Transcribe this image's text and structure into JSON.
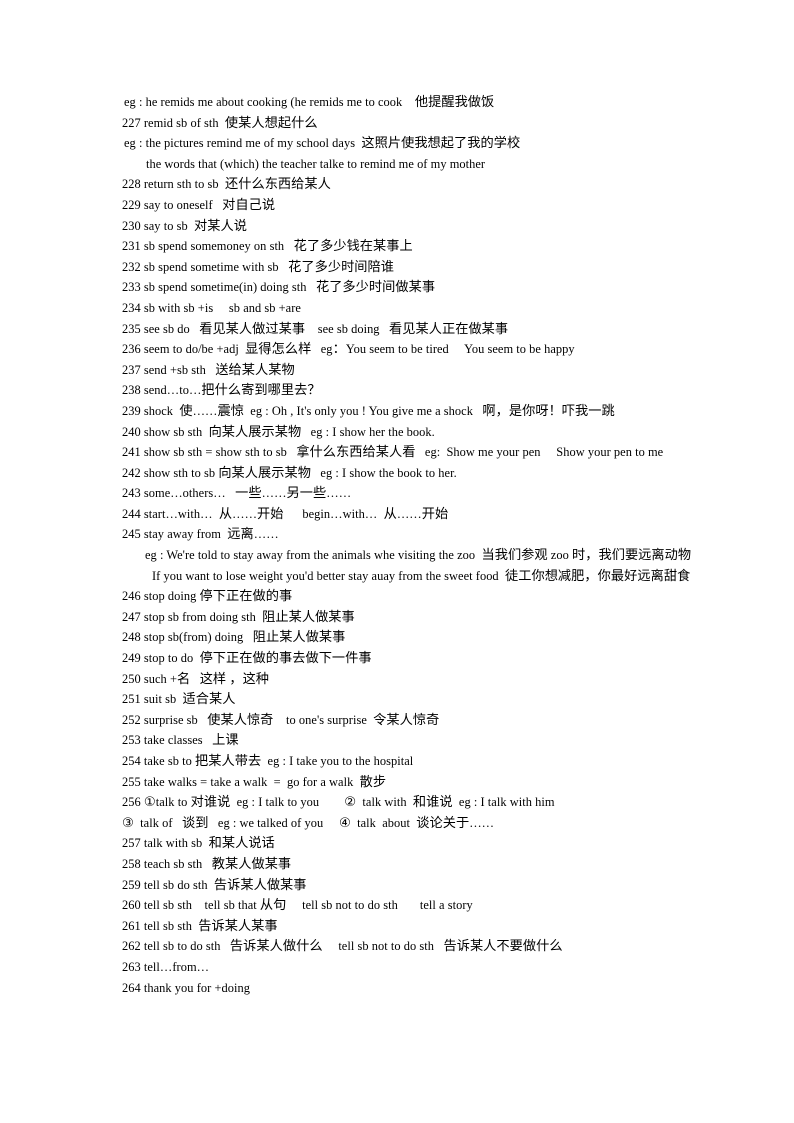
{
  "document": {
    "type": "study-notes",
    "language": "en-zh",
    "page_background": "#ffffff",
    "text_color": "#000000",
    "topic": "English phrase list with Chinese translations (items 227-264)",
    "lines": [
      {
        "id": "l1",
        "indent": "eg",
        "text": "eg : he remids me about cooking (he remids me to cook    他提醒我做饭"
      },
      {
        "id": "l2",
        "indent": "none",
        "text": "227 remid sb of sth  使某人想起什么"
      },
      {
        "id": "l3",
        "indent": "eg",
        "text": "eg : the pictures remind me of my school days  这照片使我想起了我的学校"
      },
      {
        "id": "l4",
        "indent": "deep",
        "text": "the words that (which) the teacher talke to remind me of my mother"
      },
      {
        "id": "l5",
        "indent": "none",
        "text": "228 return sth to sb  还什么东西给某人"
      },
      {
        "id": "l6",
        "indent": "none",
        "text": "229 say to oneself   对自己说"
      },
      {
        "id": "l7",
        "indent": "none",
        "text": "230 say to sb  对某人说"
      },
      {
        "id": "l8",
        "indent": "none",
        "text": "231 sb spend somemoney on sth   花了多少钱在某事上"
      },
      {
        "id": "l9",
        "indent": "none",
        "text": "232 sb spend sometime with sb   花了多少时间陪谁"
      },
      {
        "id": "l10",
        "indent": "none",
        "text": "233 sb spend sometime(in) doing sth   花了多少时间做某事"
      },
      {
        "id": "l11",
        "indent": "none",
        "text": "234 sb with sb +is     sb and sb +are"
      },
      {
        "id": "l12",
        "indent": "none",
        "text": "235 see sb do   看见某人做过某事    see sb doing   看见某人正在做某事"
      },
      {
        "id": "l13",
        "indent": "none",
        "text": "236 seem to do/be +adj  显得怎么样   eg：You seem to be tired     You seem to be happy"
      },
      {
        "id": "l14",
        "indent": "none",
        "text": "237 send +sb sth   送给某人某物"
      },
      {
        "id": "l15",
        "indent": "none",
        "text": "238 send…to…把什么寄到哪里去？"
      },
      {
        "id": "l16",
        "indent": "none",
        "text": "239 shock  使……震惊  eg : Oh , It's only you ! You give me a shock   啊，是你呀！吓我一跳"
      },
      {
        "id": "l17",
        "indent": "none",
        "text": "240 show sb sth  向某人展示某物   eg : I show her the book."
      },
      {
        "id": "l18",
        "indent": "none",
        "text": "241 show sb sth = show sth to sb   拿什么东西给某人看   eg:  Show me your pen     Show your pen to me"
      },
      {
        "id": "l19",
        "indent": "none",
        "text": "242 show sth to sb 向某人展示某物   eg : I show the book to her."
      },
      {
        "id": "l20",
        "indent": "none",
        "text": "243 some…others…   一些……另一些……"
      },
      {
        "id": "l21",
        "indent": "none",
        "text": "244 start…with…  从……开始      begin…with…  从……开始"
      },
      {
        "id": "l22",
        "indent": "none",
        "text": "245 stay away from  远离……"
      },
      {
        "id": "l23",
        "indent": "eg2",
        "text": "eg : We're told to stay away from the animals whe visiting the zoo  当我们参观 zoo 时，我们要远离动物"
      },
      {
        "id": "l24",
        "indent": "deep2",
        "text": "If you want to lose weight you'd better stay auay from the sweet food  徒工你想减肥，你最好远离甜食"
      },
      {
        "id": "l25",
        "indent": "none",
        "text": "246 stop doing 停下正在做的事"
      },
      {
        "id": "l26",
        "indent": "none",
        "text": "247 stop sb from doing sth  阻止某人做某事"
      },
      {
        "id": "l27",
        "indent": "none",
        "text": "248 stop sb(from) doing   阻止某人做某事"
      },
      {
        "id": "l28",
        "indent": "none",
        "text": "249 stop to do  停下正在做的事去做下一件事"
      },
      {
        "id": "l29",
        "indent": "none",
        "text": "250 such +名   这样 ，这种"
      },
      {
        "id": "l30",
        "indent": "none",
        "text": "251 suit sb  适合某人"
      },
      {
        "id": "l31",
        "indent": "none",
        "text": "252 surprise sb   使某人惊奇    to one's surprise  令某人惊奇"
      },
      {
        "id": "l32",
        "indent": "none",
        "text": "253 take classes   上课"
      },
      {
        "id": "l33",
        "indent": "none",
        "text": "254 take sb to 把某人带去  eg : I take you to the hospital"
      },
      {
        "id": "l34",
        "indent": "none",
        "text": "255 take walks = take a walk  =  go for a walk  散步"
      },
      {
        "id": "l35",
        "indent": "none",
        "text": "256 ①talk to 对谁说  eg : I talk to you        ②  talk with  和谁说  eg : I talk with him"
      },
      {
        "id": "l36",
        "indent": "none",
        "text": "③  talk of   谈到   eg : we talked of you     ④  talk  about  谈论关于……"
      },
      {
        "id": "l37",
        "indent": "none",
        "text": "257 talk with sb  和某人说话"
      },
      {
        "id": "l38",
        "indent": "none",
        "text": "258 teach sb sth   教某人做某事"
      },
      {
        "id": "l39",
        "indent": "none",
        "text": "259 tell sb do sth  告诉某人做某事"
      },
      {
        "id": "l40",
        "indent": "none",
        "text": "260 tell sb sth    tell sb that 从句     tell sb not to do sth       tell a story"
      },
      {
        "id": "l41",
        "indent": "none",
        "text": "261 tell sb sth  告诉某人某事"
      },
      {
        "id": "l42",
        "indent": "none",
        "text": "262 tell sb to do sth   告诉某人做什么     tell sb not to do sth   告诉某人不要做什么"
      },
      {
        "id": "l43",
        "indent": "none",
        "text": "263 tell…from…"
      },
      {
        "id": "l44",
        "indent": "none",
        "text": "264 thank you for +doing"
      }
    ]
  }
}
